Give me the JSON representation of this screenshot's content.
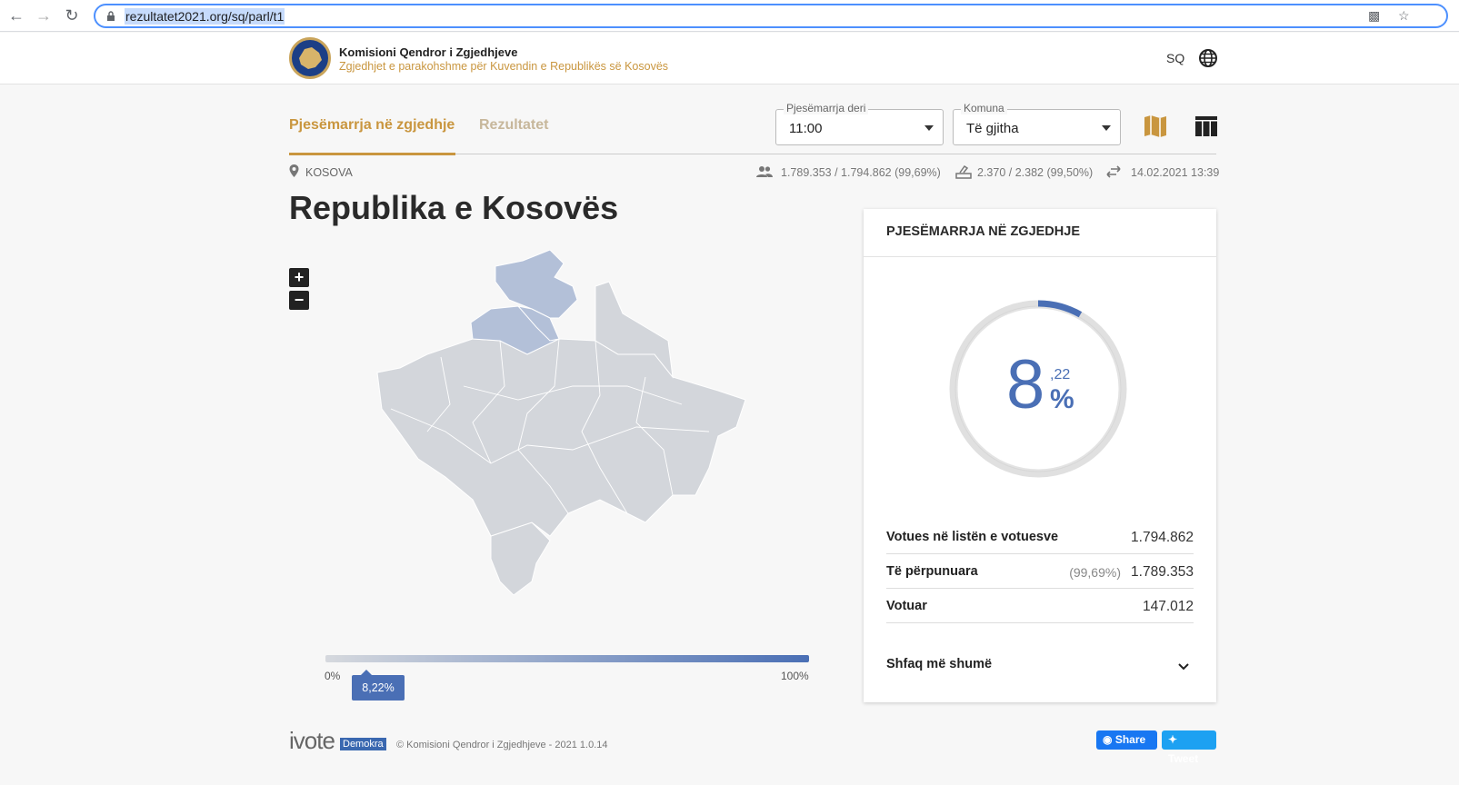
{
  "browser": {
    "url": "rezultatet2021.org/sq/parl/t1"
  },
  "header": {
    "org_name": "Komisioni Qendror i Zgjedhjeve",
    "org_sub": "Zgjedhjet e parakohshme për Kuvendin e Republikës së Kosovës",
    "lang": "SQ"
  },
  "tabs": [
    {
      "label": "Pjesëmarrja në zgjedhje"
    },
    {
      "label": "Rezultatet"
    }
  ],
  "filters": {
    "time": {
      "label": "Pjesëmarrja deri",
      "value": "11:00"
    },
    "municipality": {
      "label": "Komuna",
      "value": "Të gjitha"
    }
  },
  "info": {
    "location": "KOSOVA",
    "voters": "1.789.353 / 1.794.862 (99,69%)",
    "stations": "2.370 / 2.382 (99,50%)",
    "updated": "14.02.2021 13:39"
  },
  "title": "Republika e Kosovës",
  "map_legend": {
    "min": "0%",
    "max": "100%",
    "value_label": "8,22%",
    "value_fraction": 0.0822
  },
  "card": {
    "title": "PJESËMARRJA NË ZGJEDHJE",
    "turnout_int": "8",
    "turnout_dec": ",22",
    "turnout_sym": "%",
    "turnout_fraction": 0.0822,
    "rows": [
      {
        "label": "Votues në listën e votuesve",
        "value": "1.794.862",
        "pct": ""
      },
      {
        "label": "Të përpunuara",
        "value": "1.789.353",
        "pct": "(99,69%)"
      },
      {
        "label": "Votuar",
        "value": "147.012",
        "pct": ""
      }
    ],
    "more": "Shfaq më shumë"
  },
  "footer": {
    "brand": "ivote",
    "brand_tag": "Demokra",
    "copyright": "© Komisioni Qendror i Zgjedhjeve - 2021 1.0.14",
    "share": "Share",
    "tweet": "Tweet"
  },
  "colors": {
    "accent": "#c9963f",
    "blue": "#4a6fb5",
    "region_default": "#d3d6db",
    "region_highlight": "#b3c0d8"
  }
}
